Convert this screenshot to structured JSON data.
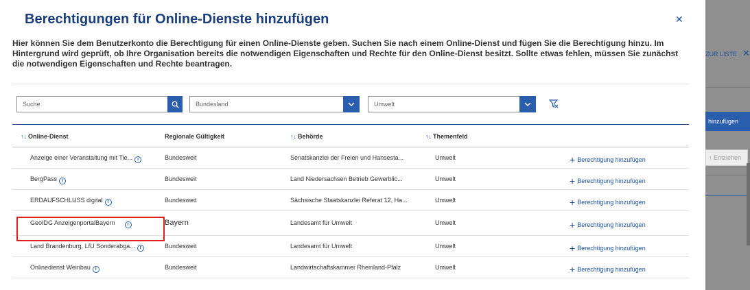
{
  "background": {
    "link_text": "ZUR LISTE",
    "add_button": "hinzufügen",
    "remove_button": "Entziehen"
  },
  "dialog": {
    "title": "Berechtigungen für Online-Dienste hinzufügen",
    "description": "Hier können Sie dem Benutzerkonto die Berechtigung für einen Online-Dienste geben. Suchen Sie nach einem Online-Dienst und fügen Sie die Berechtigung hinzu. Im Hintergrund wird geprüft, ob Ihre Organisation bereits die notwendigen Eigenschaften und Rechte für den Online-Dienst besitzt. Sollte etwas fehlen, müssen Sie zunächst die notwendigen Eigenschaften und Rechte beantragen."
  },
  "filters": {
    "search_placeholder": "Suche",
    "state_select": "Bundesland",
    "topic_select": "Umwelt"
  },
  "table": {
    "headers": {
      "service": "Online-Dienst",
      "validity": "Regionale Gültigkeit",
      "authority": "Behörde",
      "topic": "Themenfeld"
    },
    "rows": [
      {
        "service": "Anzeige einer Veranstaltung mit Tie...",
        "validity": "Bundesweit",
        "authority": "Senatskanzlei der Freien und Hansesta...",
        "topic": "Umwelt",
        "action": "Berechtigung hinzufügen"
      },
      {
        "service": "BergPass",
        "validity": "Bundesweit",
        "authority": "Land Niedersachsen Betrieb Gewerblic...",
        "topic": "Umwelt",
        "action": "Berechtigung hinzufügen"
      },
      {
        "service": "ERDAUFSCHLUSS digital",
        "validity": "Bundesweit",
        "authority": "Sächsische Staatskanzlei Referat 12, Ha...",
        "topic": "Umwelt",
        "action": "Berechtigung hinzufügen"
      },
      {
        "service": "GeoIDG AnzeigenportalBayern",
        "validity": "Bayern",
        "authority": "Landesamt für Umwelt",
        "topic": "Umwelt",
        "action": "Berechtigung hinzufügen"
      },
      {
        "service": "Land Brandenburg, LfU Sonderabga...",
        "validity": "Bundesweit",
        "authority": "Landesamt für Umwelt",
        "topic": "Umwelt",
        "action": "Berechtigung hinzufügen"
      },
      {
        "service": "Onlinedienst Weinbau",
        "validity": "Bundesweit",
        "authority": "Landwirtschaftskammer Rheinland-Pfalz",
        "topic": "Umwelt",
        "action": "Berechtigung hinzufügen"
      }
    ]
  },
  "colors": {
    "primary": "#2a5dab",
    "title": "#1a3f7a",
    "highlight": "#e0211b",
    "overlay": "#8f8f8f"
  }
}
